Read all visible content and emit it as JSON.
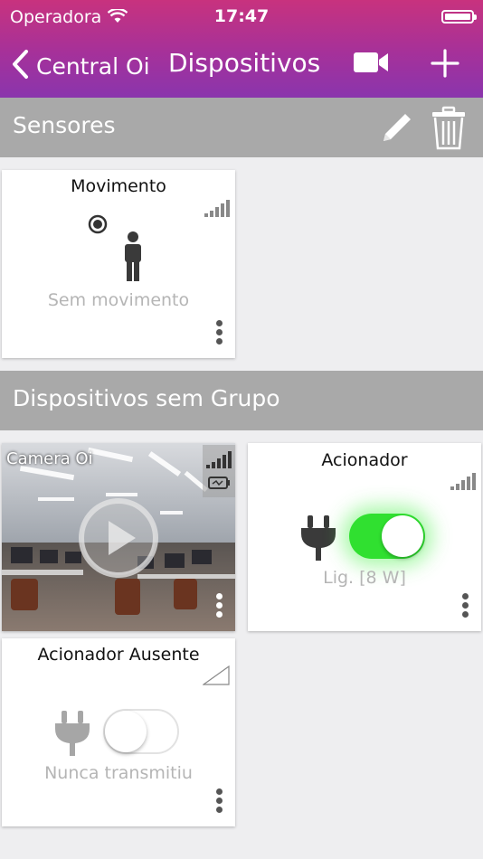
{
  "status_bar": {
    "carrier": "Operadora",
    "time": "17:47"
  },
  "nav": {
    "back_label": "Central Oi",
    "title": "Dispositivos"
  },
  "sections": [
    {
      "label": "Sensores"
    },
    {
      "label": "Dispositivos sem Grupo"
    }
  ],
  "cards": {
    "movimento": {
      "title": "Movimento",
      "status": "Sem movimento"
    },
    "camera": {
      "title": "Camera Oi"
    },
    "acionador": {
      "title": "Acionador",
      "status": "Lig. [8 W]",
      "toggle_on": true
    },
    "acionador_ausente": {
      "title": "Acionador Ausente",
      "status": "Nunca transmitiu",
      "toggle_on": false
    }
  },
  "colors": {
    "header_top": "#c8327e",
    "header_bottom": "#8a35ad",
    "section_bg": "#a9a9a9",
    "toggle_on": "#30e030"
  },
  "icons": [
    "back-chevron-icon",
    "video-camera-icon",
    "plus-icon",
    "pencil-icon",
    "trash-icon",
    "signal-icon",
    "motion-indicator-icon",
    "person-icon",
    "plug-icon",
    "play-icon",
    "battery-icon",
    "more-menu-icon"
  ]
}
